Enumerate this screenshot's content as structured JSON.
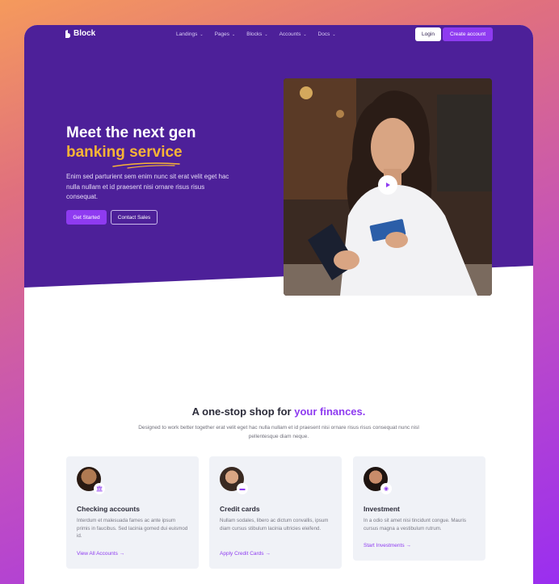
{
  "nav": {
    "logo": "Block",
    "links": [
      "Landings",
      "Pages",
      "Blocks",
      "Accounts",
      "Docs"
    ],
    "login": "Login",
    "create_account": "Create account"
  },
  "hero": {
    "title_line1": "Meet the next gen",
    "title_line2": "banking service",
    "description": "Enim sed parturient sem enim nunc sit erat velit eget hac nulla nullam et id praesent nisi ornare risus risus consequat.",
    "get_started": "Get Started",
    "contact_sales": "Contact Sales"
  },
  "section": {
    "title_plain": "A one-stop shop for ",
    "title_accent": "your finances.",
    "description": "Designed to work better together erat velit eget hac nulla nullam et id praesent nisi ornare risus risus consequat nunc nisl pellentesque diam neque."
  },
  "features": [
    {
      "title": "Checking accounts",
      "description": "Interdum et malesuada fames ac ante ipsum primis in faucibus. Sed lacinia gomed dui euismod id.",
      "link": "View All Accounts →",
      "badge_icon": "bank-icon"
    },
    {
      "title": "Credit cards",
      "description": "Nullam sodales, libero ac dictum convallis, ipsum diam cursus stibulum lacinia ultricies eleifend.",
      "link": "Apply Credit Cards →",
      "badge_icon": "credit-card-icon"
    },
    {
      "title": "Investment",
      "description": "In a odio sit amet nisi tincidunt congue. Mauris cursus magna a vestibulum rutrum.",
      "link": "Start Investments →",
      "badge_icon": "camera-icon"
    }
  ],
  "colors": {
    "hero_bg": "#4d2099",
    "accent_purple": "#8e3bf0",
    "accent_yellow": "#f8b436"
  }
}
